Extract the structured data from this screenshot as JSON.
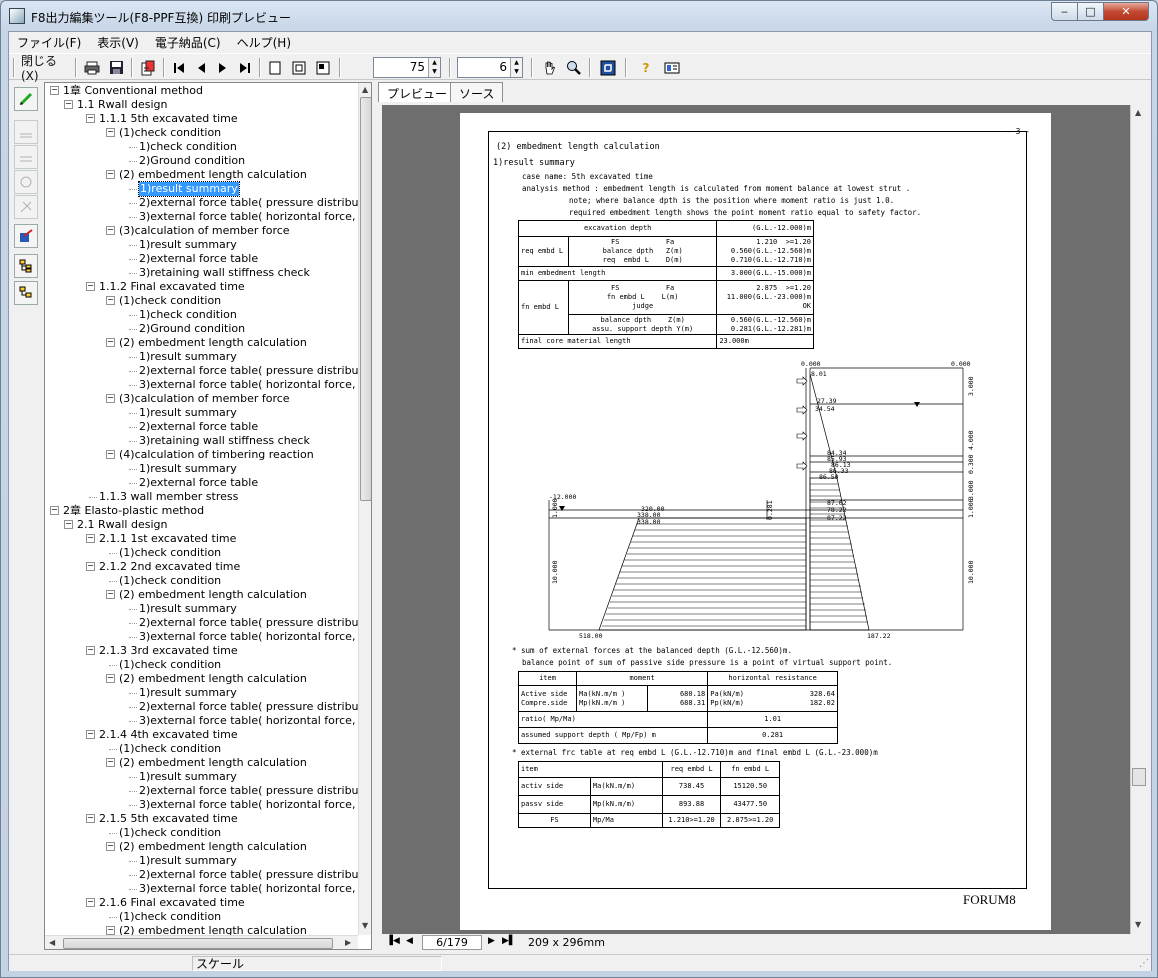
{
  "window": {
    "title": "F8出力編集ツール(F8-PPF互換) 印刷プレビュー",
    "min": "‒",
    "max": "□",
    "close": "✕"
  },
  "menu": [
    "ファイル(F)",
    "表示(V)",
    "電子納品(C)",
    "ヘルプ(H)"
  ],
  "toolbar": {
    "close_label": "閉じる(X)",
    "zoom_value": "75",
    "page_value": "6"
  },
  "tabs": [
    "プレビュー",
    "ソース"
  ],
  "tree": [
    {
      "label": "1章 Conventional method",
      "x": 0,
      "exp": "-"
    },
    {
      "label": "1.1 Rwall design",
      "x": 1,
      "exp": "-"
    },
    {
      "label": "1.1.1 5th excavated time",
      "x": 2,
      "exp": "-"
    },
    {
      "label": "(1)check condition",
      "x": 3,
      "exp": "-"
    },
    {
      "label": "1)check condition",
      "x": 4
    },
    {
      "label": "2)Ground condition",
      "x": 4
    },
    {
      "label": "(2) embedment length calculation",
      "x": 3,
      "exp": "-"
    },
    {
      "label": "1)result summary",
      "x": 4,
      "sel": true
    },
    {
      "label": "2)external force table( pressure distributio",
      "x": 4
    },
    {
      "label": "3)external force table( horizontal force, m",
      "x": 4
    },
    {
      "label": "(3)calculation of member force",
      "x": 3,
      "exp": "-"
    },
    {
      "label": "1)result summary",
      "x": 4
    },
    {
      "label": "2)external force table",
      "x": 4
    },
    {
      "label": "3)retaining wall stiffness check",
      "x": 4
    },
    {
      "label": "1.1.2 Final excavated time",
      "x": 2,
      "exp": "-"
    },
    {
      "label": "(1)check condition",
      "x": 3,
      "exp": "-"
    },
    {
      "label": "1)check condition",
      "x": 4
    },
    {
      "label": "2)Ground condition",
      "x": 4
    },
    {
      "label": "(2) embedment length calculation",
      "x": 3,
      "exp": "-"
    },
    {
      "label": "1)result summary",
      "x": 4
    },
    {
      "label": "2)external force table( pressure distributio",
      "x": 4
    },
    {
      "label": "3)external force table( horizontal force, m",
      "x": 4
    },
    {
      "label": "(3)calculation of member force",
      "x": 3,
      "exp": "-"
    },
    {
      "label": "1)result summary",
      "x": 4
    },
    {
      "label": "2)external force table",
      "x": 4
    },
    {
      "label": "3)retaining wall stiffness check",
      "x": 4
    },
    {
      "label": "(4)calculation of timbering reaction",
      "x": 3,
      "exp": "-"
    },
    {
      "label": "1)result summary",
      "x": 4
    },
    {
      "label": "2)external force table",
      "x": 4
    },
    {
      "label": "1.1.3 wall member stress",
      "x": 2
    },
    {
      "label": "2章 Elasto-plastic method",
      "x": 0,
      "exp": "-"
    },
    {
      "label": "2.1 Rwall design",
      "x": 1,
      "exp": "-"
    },
    {
      "label": "2.1.1 1st excavated time",
      "x": 2,
      "exp": "-"
    },
    {
      "label": "(1)check condition",
      "x": 3
    },
    {
      "label": "2.1.2 2nd excavated time",
      "x": 2,
      "exp": "-"
    },
    {
      "label": "(1)check condition",
      "x": 3
    },
    {
      "label": "(2) embedment length calculation",
      "x": 3,
      "exp": "-"
    },
    {
      "label": "1)result summary",
      "x": 4
    },
    {
      "label": "2)external force table( pressure distributio",
      "x": 4
    },
    {
      "label": "3)external force table( horizontal force, m",
      "x": 4
    },
    {
      "label": "2.1.3 3rd excavated time",
      "x": 2,
      "exp": "-"
    },
    {
      "label": "(1)check condition",
      "x": 3
    },
    {
      "label": "(2) embedment length calculation",
      "x": 3,
      "exp": "-"
    },
    {
      "label": "1)result summary",
      "x": 4
    },
    {
      "label": "2)external force table( pressure distributio",
      "x": 4
    },
    {
      "label": "3)external force table( horizontal force, m",
      "x": 4
    },
    {
      "label": "2.1.4 4th excavated time",
      "x": 2,
      "exp": "-"
    },
    {
      "label": "(1)check condition",
      "x": 3
    },
    {
      "label": "(2) embedment length calculation",
      "x": 3,
      "exp": "-"
    },
    {
      "label": "1)result summary",
      "x": 4
    },
    {
      "label": "2)external force table( pressure distributio",
      "x": 4
    },
    {
      "label": "3)external force table( horizontal force, m",
      "x": 4
    },
    {
      "label": "2.1.5 5th excavated time",
      "x": 2,
      "exp": "-"
    },
    {
      "label": "(1)check condition",
      "x": 3
    },
    {
      "label": "(2) embedment length calculation",
      "x": 3,
      "exp": "-"
    },
    {
      "label": "1)result summary",
      "x": 4
    },
    {
      "label": "2)external force table( pressure distributio",
      "x": 4
    },
    {
      "label": "3)external force table( horizontal force, m",
      "x": 4
    },
    {
      "label": "2.1.6 Final excavated time",
      "x": 2,
      "exp": "-"
    },
    {
      "label": "(1)check condition",
      "x": 3
    },
    {
      "label": "(2) embedment length calculation",
      "x": 3,
      "exp": "-"
    }
  ],
  "page": {
    "number": "- 3 -",
    "heading": "(2) embedment length calculation",
    "sub": "1)result summary",
    "case": "case name: 5th excavated time",
    "method": "analysis method : embedment length is calculated from moment balance at lowest strut .",
    "note1": "note; where balance dpth is the position where moment ratio is just 1.0.",
    "note2": "required embedment length shows the point moment ratio equal to safety factor.",
    "t1": {
      "r1a": "excavation depth",
      "r1b": "(G.L.-12.000)m",
      "r2lab": "req  embd L",
      "r2a": "FS           Fa\nbalance dpth   Z(m)\nreq  embd L    D(m)",
      "r2b": "1.210  >=1.20\n0.560(G.L.-12.560)m\n0.710(G.L.-12.710)m",
      "r3a": "min  embedment length",
      "r3b": "3.000(G.L.-15.000)m",
      "r4lab": "fn embd L",
      "r4a": "FS           Fa\nfn embd L    L(m)\njudge",
      "r4b": "2.875  >=1.20\n11.000(G.L.-23.000)m\nOK",
      "r5a": "balance dpth    Z(m)\nassu. support depth Y(m)",
      "r5b": "0.560(G.L.-12.560)m\n0.281(G.L.-12.281)m",
      "r6a": "final core material length",
      "r6b": "23.000m"
    },
    "diagram": {
      "top_left": "0.000",
      "top_right": "0.000",
      "v1": "8.01",
      "v2": "27.39",
      "v3": "34.54",
      "v4": "84.34",
      "v5": "85.93",
      "v6": "86.13",
      "v7": "86.33",
      "v8": "86.50",
      "v9": "87.02",
      "v10": "78.22",
      "v11": "87.22",
      "l1": "-12.000",
      "l2": "320.00",
      "l3": "338.00",
      "l4": "338.00",
      "l5": "0.281",
      "bot_left": "518.00",
      "bot_right": "187.22",
      "d1": "3.000",
      "d2": "4.000",
      "d3": "0.300",
      "d4": "3.000",
      "d5": "1.000",
      "d6": "10.000",
      "dl1": "1.000",
      "dl2": "10.000"
    },
    "note3": "* sum of external forces at the balanced depth (G.L.-12.560)m.",
    "note4": "balance point of sum of passive side pressure is a point of virtual support point.",
    "t2": {
      "h1": "item",
      "h2": "moment",
      "h3": "horizontal resistance",
      "r1a": "Active side\nCompre.side",
      "r1b": "Ma(kN.m/m )\nMp(kN.m/m )",
      "r1c": "680.18\n688.31",
      "r1d": "Pa(kN/m)\nPp(kN/m)",
      "r1e": "328.64\n182.02",
      "r2a": "ratio( Mp/Ma)",
      "r2b": "1.01",
      "r3a": "assumed support depth   ( Mp/Fp)    m",
      "r3b": "0.281"
    },
    "note5": "* external frc table at req embd L (G.L.-12.710)m and final embd L (G.L.-23.000)m",
    "t3": {
      "h1": "item",
      "h2": "req  embd L",
      "h3": "fn embd L",
      "r1a": "activ side",
      "r1b": "Ma(kN.m/m)",
      "r1c": "738.45",
      "r1d": "15120.50",
      "r2a": "passv side",
      "r2b": "Mp(kN.m/m)",
      "r2c": "893.88",
      "r2d": "43477.50",
      "r3a": "FS",
      "r3b": "Mp/Ma",
      "r3c": "1.210>=1.20",
      "r3d": "2.875>=1.20"
    },
    "footer": "FORUM8"
  },
  "nav": {
    "page": "6/179",
    "size": "209 x 296mm"
  },
  "status": {
    "scale": "スケール"
  }
}
